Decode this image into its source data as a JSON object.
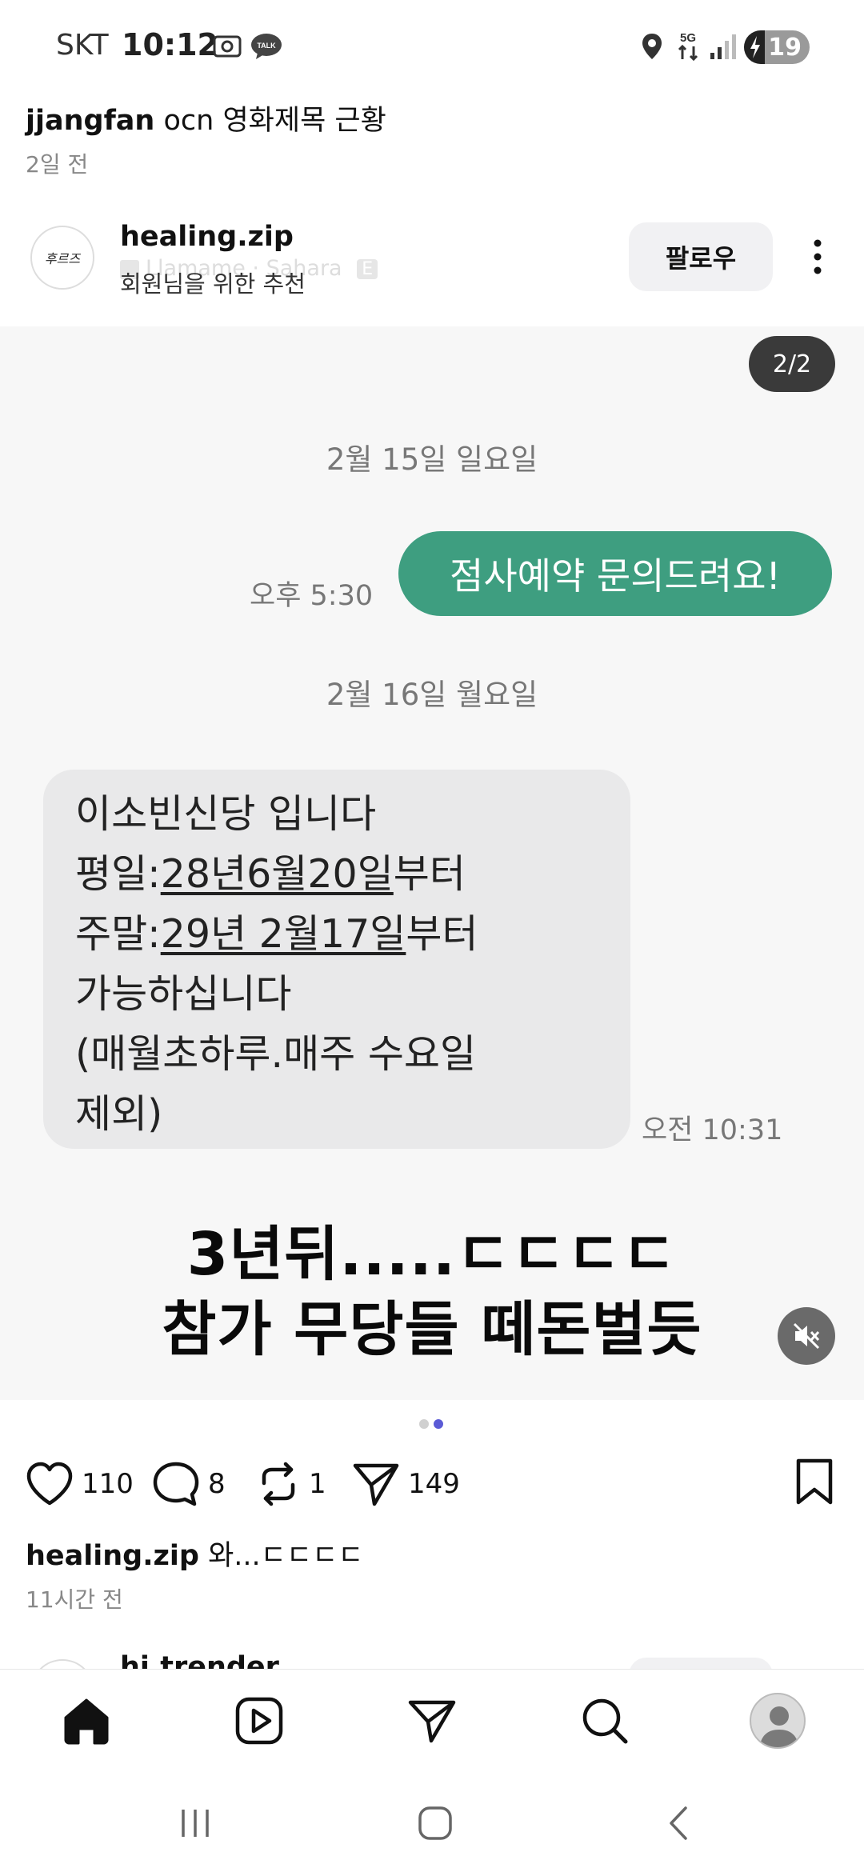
{
  "status_bar": {
    "carrier": "SKT",
    "time": "10:12",
    "network": "5G",
    "battery": "19"
  },
  "repost": {
    "user": "jjangfan",
    "text": "ocn 영화제목 근황",
    "time": "2일 전"
  },
  "author": {
    "avatar_text": "후르즈",
    "name": "healing.zip",
    "music_hint": "Llamame · Sahara",
    "explicit_badge": "E",
    "subtitle": "회원님을 위한 추천",
    "follow_label": "팔로우"
  },
  "media": {
    "page_indicator": "2/2",
    "chat": {
      "date1": "2월 15일 일요일",
      "sent_time": "오후 5:30",
      "sent_message": "점사예약 문의드려요!",
      "date2": "2월 16일 월요일",
      "received_lines": {
        "l1": "이소빈신당 입니다",
        "l2_prefix": "평일:",
        "l2_underlined": "28년6월20일",
        "l2_suffix": "부터",
        "l3_prefix": "주말:",
        "l3_underlined": "29년 2월17일",
        "l3_suffix": "부터",
        "l4": "가능하십니다",
        "l5": "(매월초하루.매주 수요일",
        "l6": "제외)"
      },
      "received_time": "오전 10:31"
    },
    "caption_line1": "3년뒤.....ㄷㄷㄷㄷ",
    "caption_line2": "참가 무당들 떼돈벌듯",
    "carousel_current": 2,
    "carousel_total": 2
  },
  "actions": {
    "likes": "110",
    "comments": "8",
    "reposts": "1",
    "shares": "149"
  },
  "post": {
    "author": "healing.zip",
    "text": "와...ㄷㄷㄷㄷ",
    "time": "11시간 전"
  },
  "next_post": {
    "author_peek": "hi.trender"
  },
  "colors": {
    "sent_bubble": "#3e9e80",
    "received_bubble": "#e9e9ea",
    "active_dot": "#5b5bd6"
  }
}
